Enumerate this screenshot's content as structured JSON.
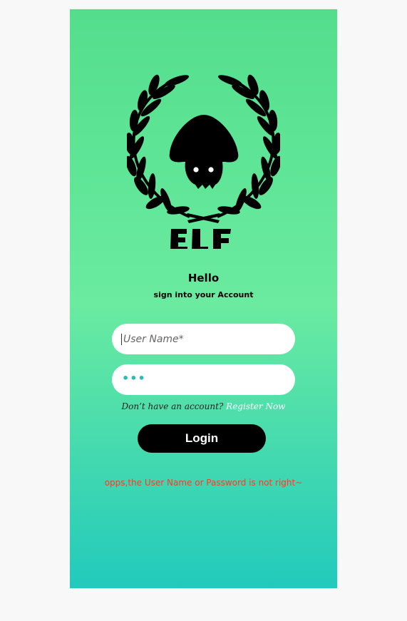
{
  "brand": {
    "logo_text": "ELF"
  },
  "greeting": {
    "title": "Hello",
    "subtitle": "sign into your Account"
  },
  "form": {
    "username_placeholder": "User Name*",
    "username_value": "",
    "password_display": "•••"
  },
  "register": {
    "prompt": "Don’t have an account? ",
    "link_label": "Register Now"
  },
  "login": {
    "button_label": "Login"
  },
  "error": {
    "message": "opps,the User Name or Password is not right~"
  },
  "colors": {
    "gradient_top": "#53de8c",
    "gradient_mid": "#6aeba0",
    "gradient_bottom": "#22cabc",
    "error": "#ff3b1f",
    "input_text": "#2bbdb3"
  }
}
